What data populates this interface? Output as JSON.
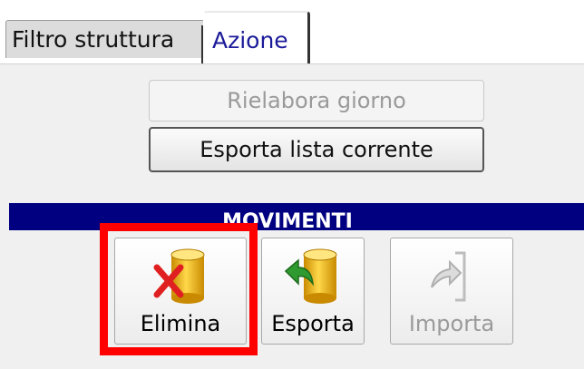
{
  "tabs": [
    {
      "label": "Filtro struttura",
      "active": false
    },
    {
      "label": "Azione",
      "active": true
    }
  ],
  "actions": {
    "rielabora_label": "Rielabora giorno",
    "esporta_lista_label": "Esporta lista corrente"
  },
  "section": {
    "title": "MOVIMENTI"
  },
  "movimenti_buttons": [
    {
      "label": "Elimina",
      "icon": "db-delete-icon",
      "enabled": true,
      "highlighted": true
    },
    {
      "label": "Esporta",
      "icon": "db-export-icon",
      "enabled": true
    },
    {
      "label": "Importa",
      "icon": "import-icon",
      "enabled": false
    }
  ],
  "colors": {
    "section_header": "#000080",
    "highlight": "#ff0000",
    "tab_active_text": "#1b1b9a"
  }
}
